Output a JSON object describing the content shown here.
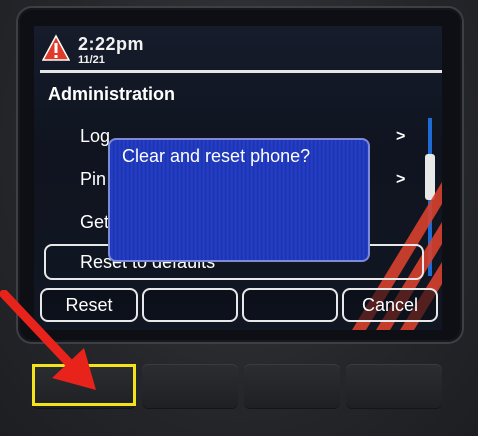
{
  "status": {
    "time": "2:22pm",
    "date": "11/21"
  },
  "menu": {
    "title": "Administration",
    "items": [
      {
        "label": "Log",
        "chevron": ">"
      },
      {
        "label": "Pin",
        "chevron": ">"
      },
      {
        "label": "Get",
        "chevron": ""
      },
      {
        "label": "Reset to defaults",
        "chevron": ""
      }
    ]
  },
  "dialog": {
    "title": "Clear and reset phone?"
  },
  "softkeys": {
    "reset": "Reset",
    "key2": "",
    "key3": "",
    "cancel": "Cancel"
  },
  "colors": {
    "accent_red": "#e03a2a",
    "dialog_blue": "#2540c8",
    "highlight_yellow": "#f4e21a"
  },
  "icons": {
    "alert": "alert-triangle-icon",
    "arrow": "red-arrow-annotation"
  }
}
